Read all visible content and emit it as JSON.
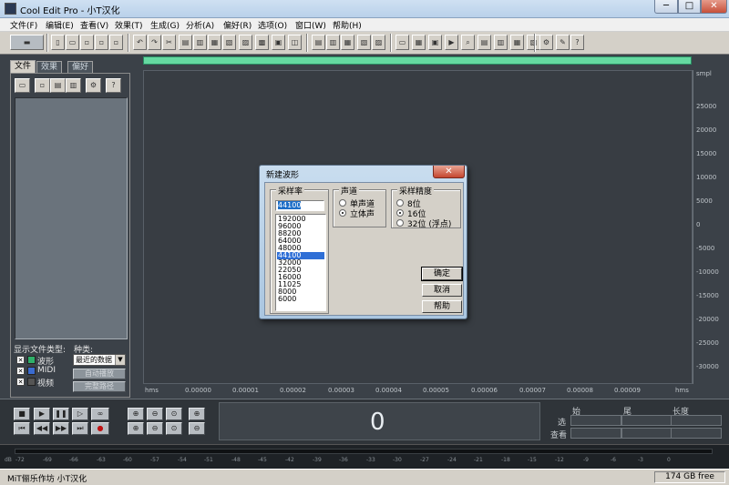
{
  "window": {
    "title": "Cool Edit Pro  - 小T汉化",
    "min": "─",
    "max": "□",
    "close": "✕"
  },
  "menu": [
    "文件(F)",
    "编辑(E)",
    "查看(V)",
    "效果(T)",
    "生成(G)",
    "分析(A)",
    "偏好(R)",
    "选项(O)",
    "窗口(W)",
    "帮助(H)"
  ],
  "left_panel": {
    "tabs": [
      "文件",
      "效果",
      "偏好"
    ],
    "show_types_label": "显示文件类型:",
    "types": [
      "波形",
      "MIDI",
      "视频"
    ],
    "sort_label": "种类:",
    "sort_value": "最近的数据",
    "auto_play": "自动播放",
    "full_path": "完整路径"
  },
  "ruler_right": {
    "unit": "smpl",
    "ticks": [
      "25000",
      "20000",
      "15000",
      "10000",
      "5000",
      "0",
      "-5000",
      "-10000",
      "-15000",
      "-20000",
      "-25000",
      "-30000"
    ]
  },
  "ruler_bottom": {
    "unit": "hms",
    "ticks": [
      "0.00000",
      "0.00001",
      "0.00002",
      "0.00003",
      "0.00004",
      "0.00005",
      "0.00006",
      "0.00007",
      "0.00008",
      "0.00009"
    ]
  },
  "dialog": {
    "title": "新建波形",
    "close": "✕",
    "sample_rate_label": "采样率",
    "sample_rate_value": "44100",
    "rates": [
      "192000",
      "96000",
      "88200",
      "64000",
      "48000",
      "44100",
      "32000",
      "22050",
      "16000",
      "11025",
      "8000",
      "6000"
    ],
    "selected_rate_index": 5,
    "channels_label": "声道",
    "channels": [
      "单声道",
      "立体声"
    ],
    "selected_channel": "立体声",
    "resolution_label": "采样精度",
    "resolutions": [
      "8位",
      "16位",
      "32位 (浮点)"
    ],
    "selected_resolution": "16位",
    "ok": "确定",
    "cancel": "取消",
    "help": "帮助"
  },
  "transport": {
    "time": "0",
    "sel_headers": [
      "始",
      "尾",
      "长度"
    ],
    "row_select": "选",
    "row_view": "查看"
  },
  "meter": {
    "unit": "dB",
    "ticks": [
      "-72",
      "-69",
      "-66",
      "-63",
      "-60",
      "-57",
      "-54",
      "-51",
      "-48",
      "-45",
      "-42",
      "-39",
      "-36",
      "-33",
      "-30",
      "-27",
      "-24",
      "-21",
      "-18",
      "-15",
      "-12",
      "-9",
      "-6",
      "-3",
      "0"
    ]
  },
  "status": {
    "left": "MiT俪乐作坊 小T汉化",
    "free": "174 GB free"
  }
}
